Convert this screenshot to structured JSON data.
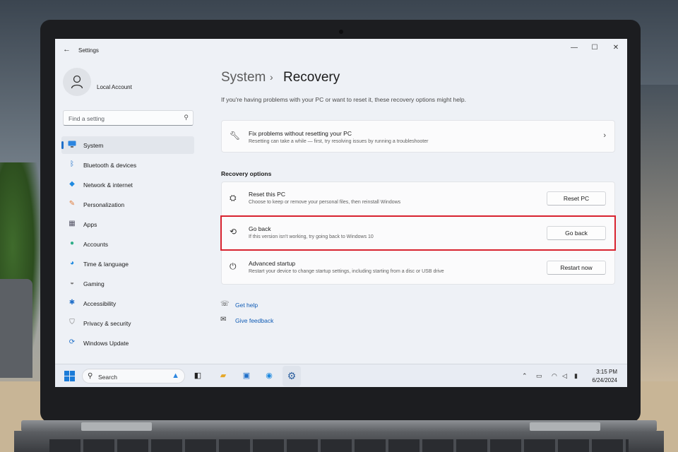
{
  "window": {
    "title": "Settings",
    "back_glyph": "←",
    "minimize_glyph": "—",
    "maximize_glyph": "☐",
    "close_glyph": "✕"
  },
  "account": {
    "name": "Local Account"
  },
  "search": {
    "placeholder": "Find a setting"
  },
  "sidebar": {
    "items": [
      {
        "label": "System",
        "icon": "monitor-icon",
        "selected": true
      },
      {
        "label": "Bluetooth & devices",
        "icon": "bluetooth-icon"
      },
      {
        "label": "Network & internet",
        "icon": "wifi-icon"
      },
      {
        "label": "Personalization",
        "icon": "brush-icon"
      },
      {
        "label": "Apps",
        "icon": "apps-icon"
      },
      {
        "label": "Accounts",
        "icon": "person-icon"
      },
      {
        "label": "Time & language",
        "icon": "globe-clock-icon"
      },
      {
        "label": "Gaming",
        "icon": "gamepad-icon"
      },
      {
        "label": "Accessibility",
        "icon": "accessibility-icon"
      },
      {
        "label": "Privacy & security",
        "icon": "shield-icon"
      },
      {
        "label": "Windows Update",
        "icon": "update-icon"
      }
    ]
  },
  "breadcrumb": {
    "parent": "System",
    "separator": "›",
    "current": "Recovery"
  },
  "intro": "If you're having problems with your PC or want to reset it, these recovery options might help.",
  "fix_card": {
    "title": "Fix problems without resetting your PC",
    "description": "Resetting can take a while — first, try resolving issues by running a troubleshooter",
    "chevron": "›"
  },
  "recovery_options": {
    "heading": "Recovery options",
    "items": [
      {
        "title": "Reset this PC",
        "description": "Choose to keep or remove your personal files, then reinstall Windows",
        "button": "Reset PC",
        "icon": "reset-pc-icon"
      },
      {
        "title": "Go back",
        "description": "If this version isn't working, try going back to Windows 10",
        "button": "Go back",
        "icon": "history-icon",
        "highlighted": true
      },
      {
        "title": "Advanced startup",
        "description": "Restart your device to change startup settings, including starting from a disc or USB drive",
        "button": "Restart now",
        "icon": "advanced-startup-icon"
      }
    ]
  },
  "links": {
    "help": "Get help",
    "feedback": "Give feedback"
  },
  "taskbar": {
    "search_label": "Search",
    "apps": [
      "task-view-icon",
      "file-explorer-icon",
      "store-icon",
      "edge-icon",
      "settings-icon"
    ],
    "time": "3:15 PM",
    "date": "6/24/2024"
  },
  "colors": {
    "accent": "#1f6fc9",
    "highlight": "#d8232f",
    "link": "#0f5bb5"
  }
}
